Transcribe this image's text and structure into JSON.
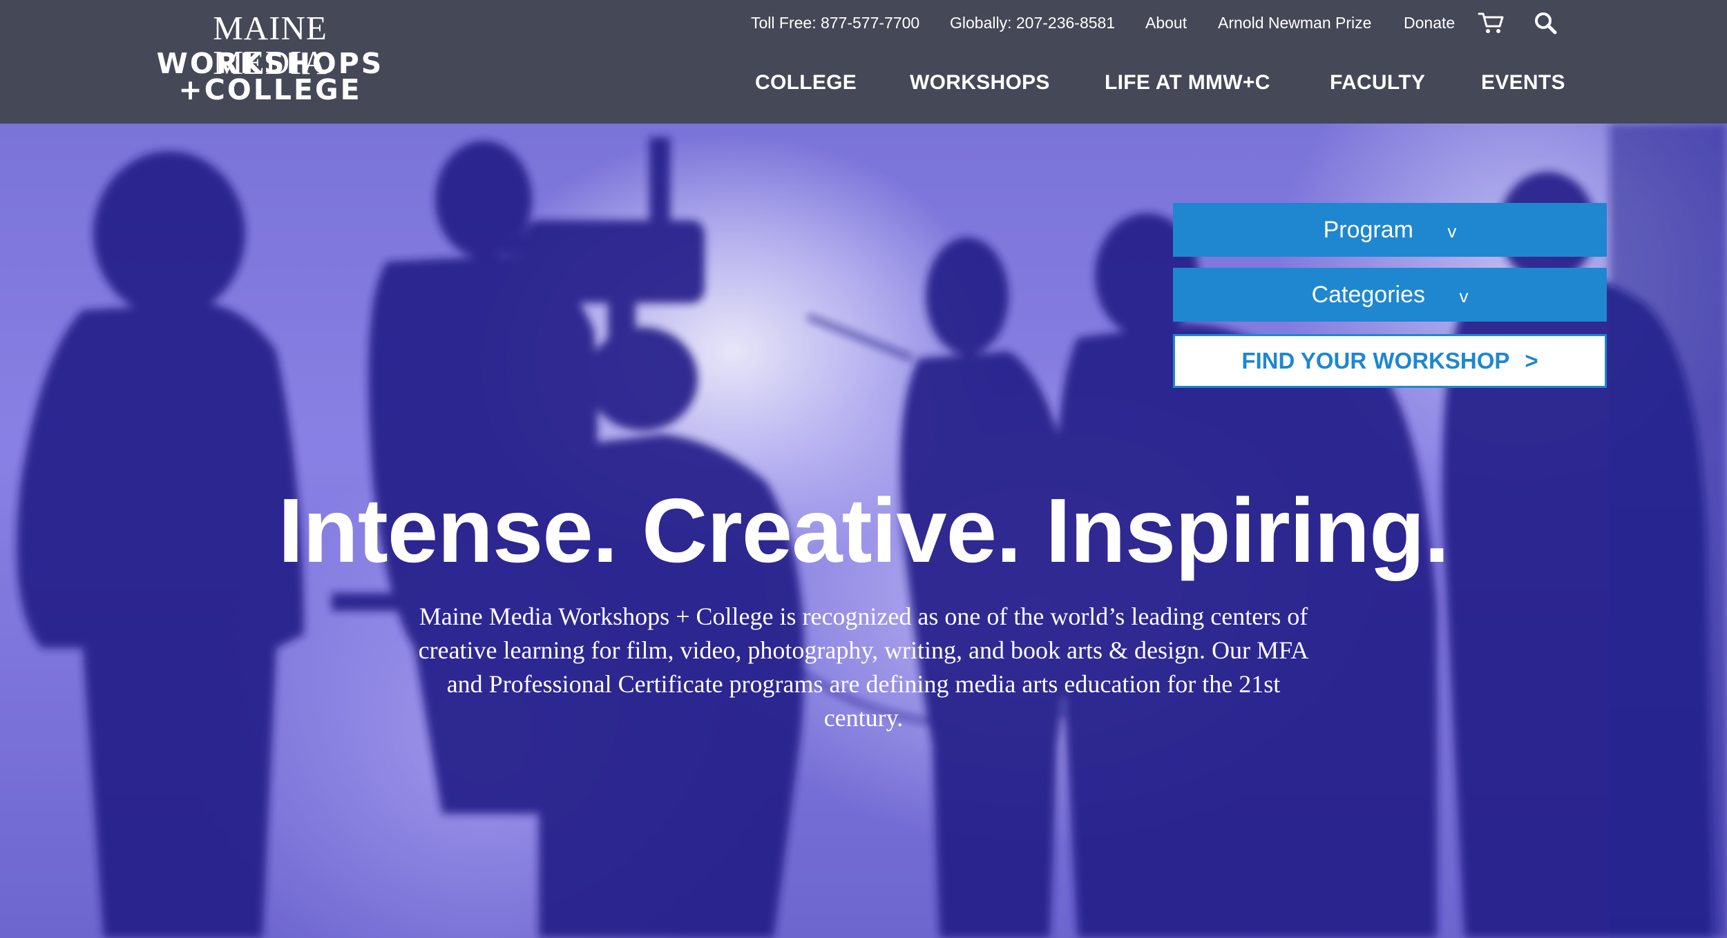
{
  "logo": {
    "line1": "MAINE MEDIA",
    "line2": "WORKSHOPS",
    "line3": "+COLLEGE"
  },
  "utility": {
    "toll_free": "Toll Free: 877-577-7700",
    "globally": "Globally: 207-236-8581",
    "about": "About",
    "prize": "Arnold Newman Prize",
    "donate": "Donate",
    "cart_icon": "cart-icon",
    "search_icon": "search-icon"
  },
  "nav": {
    "college": "COLLEGE",
    "workshops": "WORKSHOPS",
    "life": "LIFE AT MMW+C",
    "faculty": "FACULTY",
    "events": "EVENTS"
  },
  "finder": {
    "program_label": "Program",
    "program_caret": "v",
    "categories_label": "Categories",
    "categories_caret": "v",
    "button_label": "FIND YOUR WORKSHOP",
    "button_arrow": ">"
  },
  "hero": {
    "title": "Intense. Creative. Inspiring.",
    "text": "Maine Media Workshops + College is recognized as one of the world’s leading centers of creative learning for film, video, photography, writing, and book arts & design. Our MFA and Professional Certificate programs are defining media arts education for the 21st century."
  },
  "colors": {
    "header_bg": "#454856",
    "accent_blue": "#1e87d0",
    "text_white": "#ffffff"
  }
}
